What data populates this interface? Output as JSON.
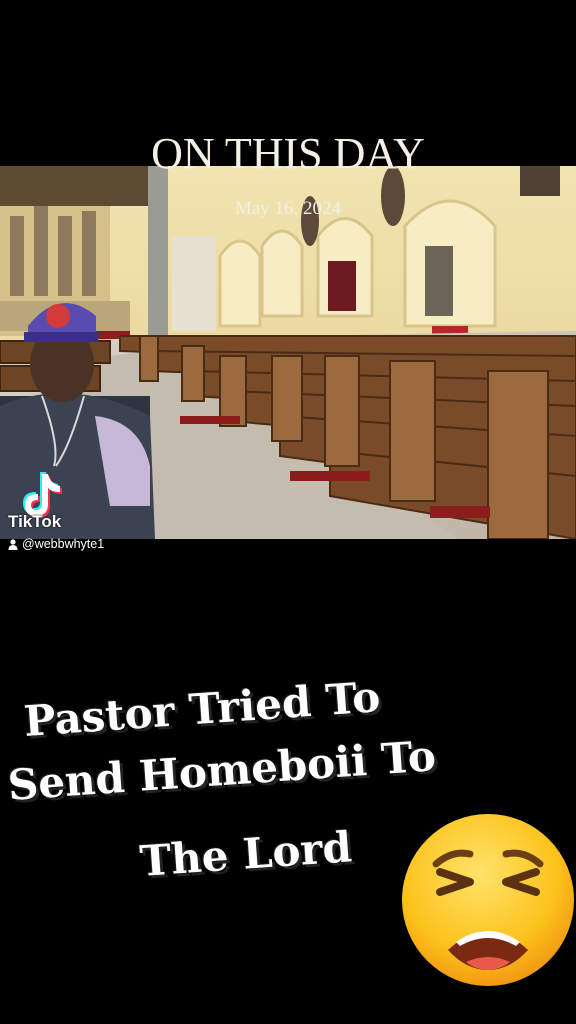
{
  "overlay": {
    "title": "ON THIS DAY",
    "date": "May 16, 2024"
  },
  "watermark": {
    "brand": "TikTok",
    "handle": "@webbwhyte1",
    "icon": "tiktok-logo-icon"
  },
  "caption": {
    "line1": "Pastor Tried To",
    "line2": "Send Homeboii To",
    "line3": "The Lord"
  },
  "emoji": "weary-face-emoji",
  "colors": {
    "background": "#000000",
    "church_wall": "#e9d9a6",
    "pew": "#8a5a33",
    "aisle": "#c8c0b4",
    "text": "#ffffff"
  }
}
